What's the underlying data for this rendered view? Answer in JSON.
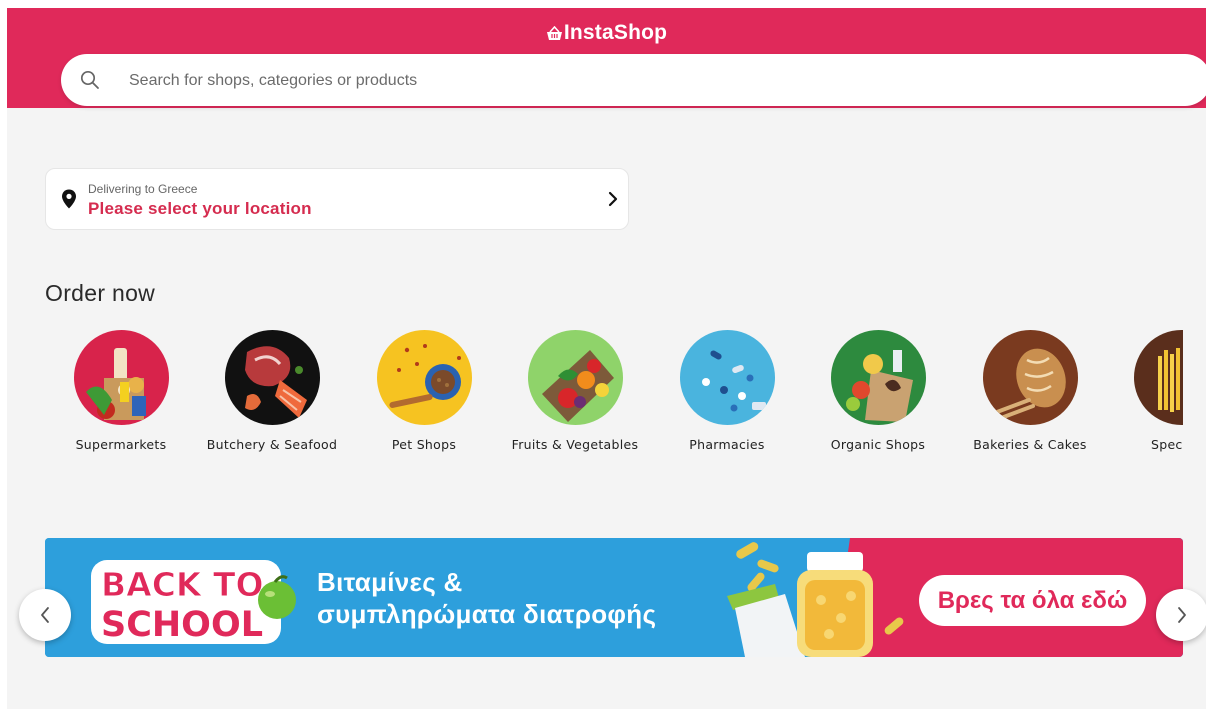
{
  "header": {
    "brand": "InstaShop",
    "search_placeholder": "Search for shops, categories or products"
  },
  "location": {
    "caption": "Delivering to Greece",
    "prompt": "Please select your location"
  },
  "order_now": {
    "title": "Order now",
    "categories": [
      {
        "label": "Supermarkets"
      },
      {
        "label": "Butchery & Seafood"
      },
      {
        "label": "Pet Shops"
      },
      {
        "label": "Fruits & Vegetables"
      },
      {
        "label": "Pharmacies"
      },
      {
        "label": "Organic Shops"
      },
      {
        "label": "Bakeries & Cakes"
      },
      {
        "label": "Specialty"
      }
    ]
  },
  "banner": {
    "logo_line1": "BACK TO",
    "logo_line2": "SCHOOL",
    "headline_line1": "Βιταμίνες &",
    "headline_line2": "συμπληρώματα διατροφής",
    "cta": "Βρες τα όλα εδώ"
  },
  "colors": {
    "brand": "#e0295a",
    "location_text": "#d52c4f",
    "banner_blue": "#2d9fdc"
  }
}
